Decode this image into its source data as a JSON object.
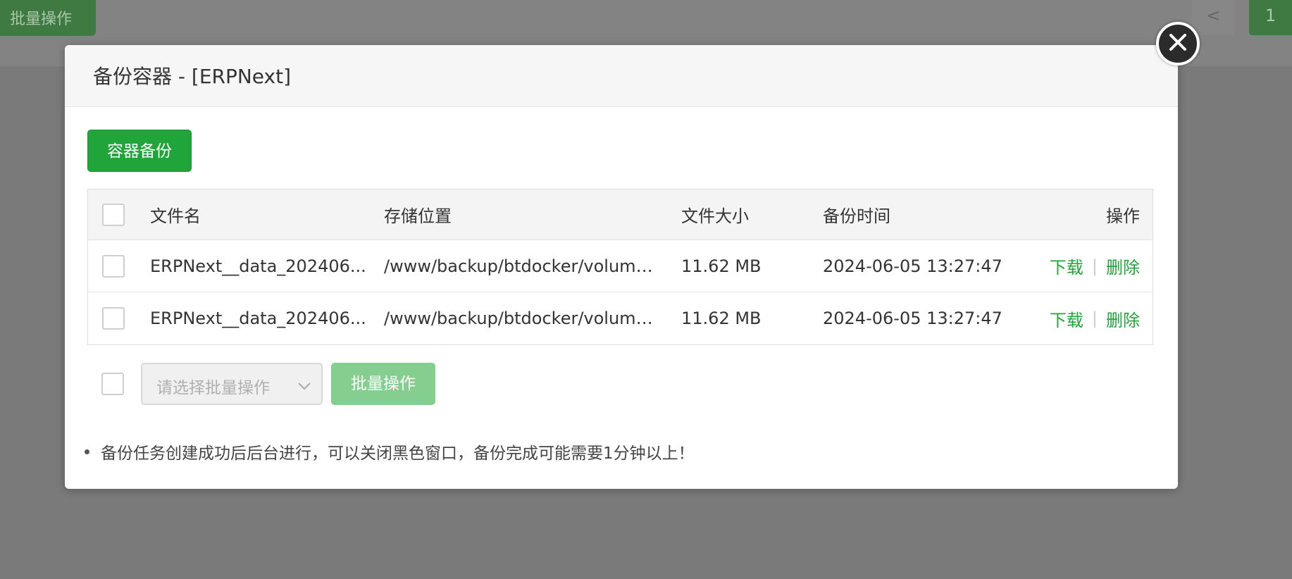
{
  "background": {
    "batch_button_label": "批量操作",
    "prev_page_label": "<",
    "current_page": "1"
  },
  "modal": {
    "title": "备份容器 - [ERPNext]",
    "backup_button_label": "容器备份",
    "table": {
      "columns": [
        "文件名",
        "存储位置",
        "文件大小",
        "备份时间",
        "操作"
      ],
      "rows": [
        {
          "file_name": "ERPNext__data_202406...",
          "location": "/www/backup/btdocker/volume...",
          "size": "11.62 MB",
          "time": "2024-06-05 13:27:47",
          "download_label": "下载",
          "delete_label": "删除"
        },
        {
          "file_name": "ERPNext__data_202406...",
          "location": "/www/backup/btdocker/volume...",
          "size": "11.62 MB",
          "time": "2024-06-05 13:27:47",
          "download_label": "下载",
          "delete_label": "删除"
        }
      ]
    },
    "batch": {
      "select_placeholder": "请选择批量操作",
      "button_label": "批量操作"
    },
    "tip": "备份任务创建成功后后台进行，可以关闭黑色窗口，备份完成可能需要1分钟以上！",
    "separator": "|"
  },
  "colors": {
    "primary": "#20a53a",
    "primary_disabled": "#84cf8f",
    "overlay": "#7a7a7a"
  }
}
